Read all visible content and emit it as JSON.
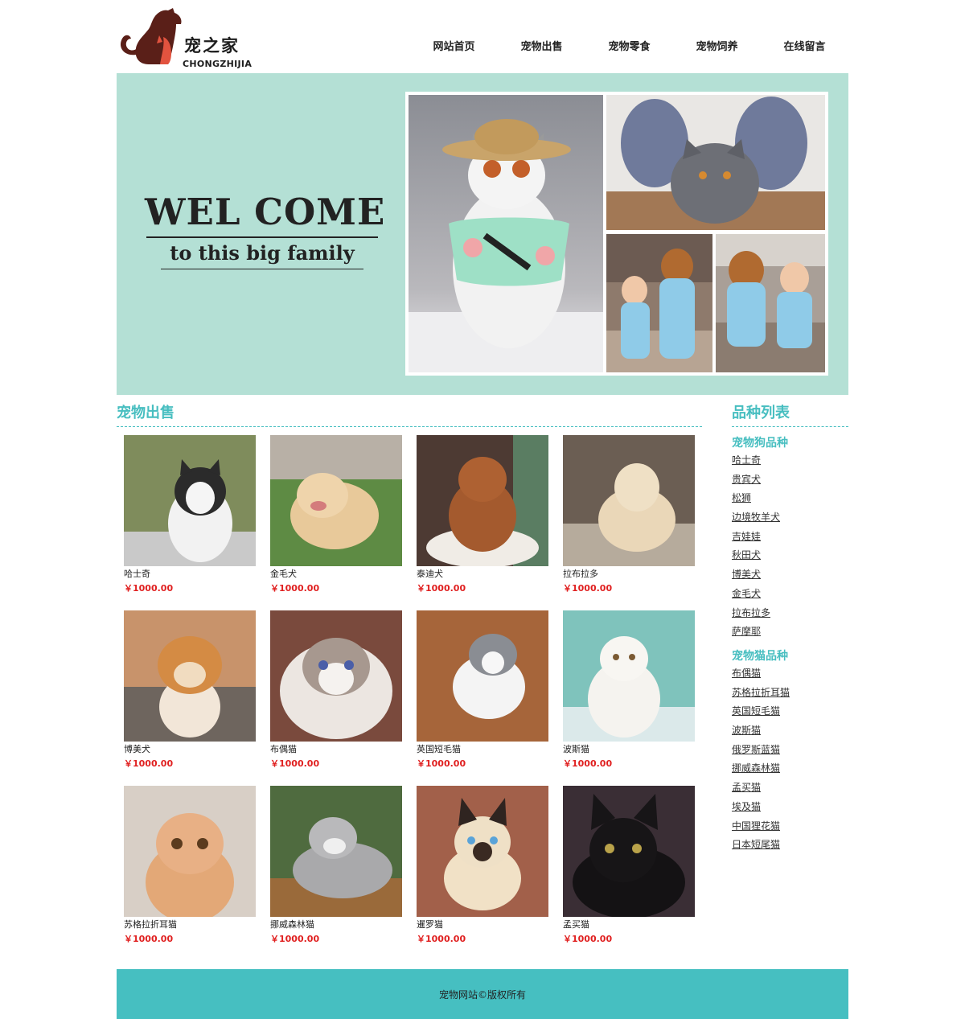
{
  "header": {
    "logo_cn": "宠之家",
    "logo_en": "CHONGZHIJIA",
    "nav": [
      "网站首页",
      "宠物出售",
      "宠物零食",
      "宠物饲养",
      "在线留言"
    ]
  },
  "banner": {
    "title": "WEL COME",
    "subtitle": "to this big family"
  },
  "sale": {
    "title": "宠物出售",
    "items": [
      {
        "name": "哈士奇",
        "price": "￥1000.00"
      },
      {
        "name": "金毛犬",
        "price": "￥1000.00"
      },
      {
        "name": "泰迪犬",
        "price": "￥1000.00"
      },
      {
        "name": "拉布拉多",
        "price": "￥1000.00"
      },
      {
        "name": "博美犬",
        "price": "￥1000.00"
      },
      {
        "name": "布偶猫",
        "price": "￥1000.00"
      },
      {
        "name": "英国短毛猫",
        "price": "￥1000.00"
      },
      {
        "name": "波斯猫",
        "price": "￥1000.00"
      },
      {
        "name": "苏格拉折耳猫",
        "price": "￥1000.00"
      },
      {
        "name": "挪威森林猫",
        "price": "￥1000.00"
      },
      {
        "name": "暹罗猫",
        "price": "￥1000.00"
      },
      {
        "name": "孟买猫",
        "price": "￥1000.00"
      }
    ]
  },
  "breeds": {
    "title": "品种列表",
    "dog_title": "宠物狗品种",
    "dogs": [
      "哈士奇",
      "贵宾犬",
      "松狮",
      "边境牧羊犬",
      "吉娃娃",
      "秋田犬",
      "博美犬",
      "金毛犬",
      "拉布拉多",
      "萨摩耶"
    ],
    "cat_title": "宠物猫品种",
    "cats": [
      "布偶猫",
      "苏格拉折耳猫",
      "英国短毛猫",
      "波斯猫",
      "俄罗斯蓝猫",
      "挪威森林猫",
      "孟买猫",
      "埃及猫",
      "中国狸花猫",
      "日本短尾猫"
    ]
  },
  "footer": {
    "text": "宠物网站©版权所有"
  },
  "colors": {
    "accent": "#47bec0",
    "banner_bg": "#b4e0d5",
    "price": "#e02020"
  }
}
